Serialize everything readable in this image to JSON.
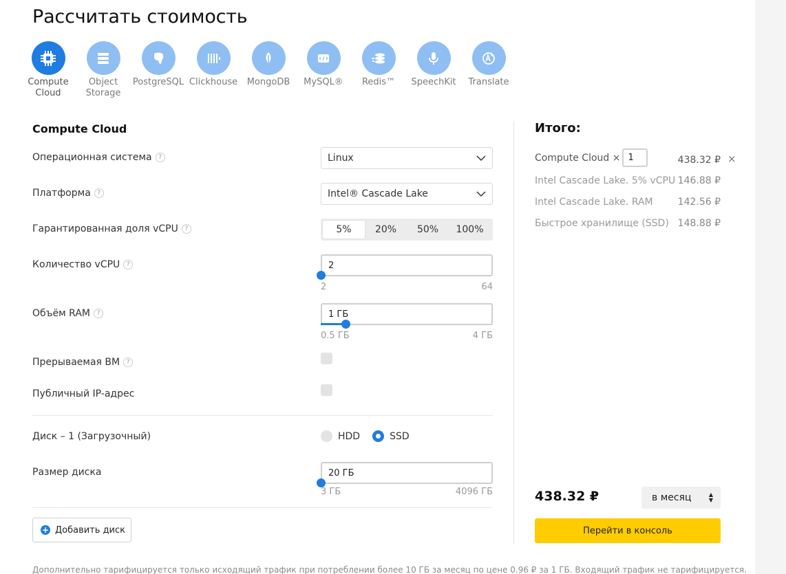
{
  "page_title": "Рассчитать стоимость",
  "services": [
    {
      "label": "Compute\nCloud",
      "icon": "chip-icon",
      "active": true
    },
    {
      "label": "Object\nStorage",
      "icon": "storage-icon",
      "active": false
    },
    {
      "label": "PostgreSQL",
      "icon": "postgresql-icon",
      "active": false
    },
    {
      "label": "Clickhouse",
      "icon": "clickhouse-icon",
      "active": false
    },
    {
      "label": "MongoDB",
      "icon": "mongodb-icon",
      "active": false
    },
    {
      "label": "MySQL®",
      "icon": "mysql-icon",
      "active": false
    },
    {
      "label": "Redis™",
      "icon": "redis-icon",
      "active": false
    },
    {
      "label": "SpeechKit",
      "icon": "microphone-icon",
      "active": false
    },
    {
      "label": "Translate",
      "icon": "translate-icon",
      "active": false
    }
  ],
  "config": {
    "section_title": "Compute Cloud",
    "os": {
      "label": "Операционная система",
      "value": "Linux"
    },
    "platform": {
      "label": "Платформа",
      "value": "Intel® Cascade Lake"
    },
    "vcpu_share": {
      "label": "Гарантированная доля vCPU",
      "options": [
        "5%",
        "20%",
        "50%",
        "100%"
      ],
      "selected": "5%"
    },
    "vcpu_count": {
      "label": "Количество vCPU",
      "value": "2",
      "min": "2",
      "max": "64",
      "level": 0.0
    },
    "ram": {
      "label": "Объём RAM",
      "value": "1 ГБ",
      "min": "0.5 ГБ",
      "max": "4 ГБ",
      "level": 0.143
    },
    "preemptible": {
      "label": "Прерываемая ВМ",
      "checked": false
    },
    "public_ip": {
      "label": "Публичный IP-адрес",
      "checked": false
    },
    "disk": {
      "label": "Диск – 1 (Загрузочный)",
      "options": [
        "HDD",
        "SSD"
      ],
      "selected": "SSD"
    },
    "disk_size": {
      "label": "Размер диска",
      "value": "20 ГБ",
      "min": "3 ГБ",
      "max": "4096 ГБ",
      "level": 0.0
    },
    "add_disk_label": "Добавить диск",
    "help_glyph": "?"
  },
  "summary": {
    "title": "Итого:",
    "main_item": {
      "name": "Compute Cloud ×",
      "qty": "1",
      "price": "438.32 ₽"
    },
    "items": [
      {
        "name": "Intel Cascade Lake. 5% vCPU",
        "price": "146.88 ₽"
      },
      {
        "name": "Intel Cascade Lake. RAM",
        "price": "142.56 ₽"
      },
      {
        "name": "Быстрое хранилище (SSD)",
        "price": "148.88 ₽"
      }
    ],
    "total": "438.32 ₽",
    "period": "в месяц",
    "console_button": "Перейти в консоль",
    "remove_glyph": "×"
  },
  "footnote": "Дополнительно тарифицируется только исходящий трафик при потреблении более 10 ГБ за месяц по цене 0.96 ₽ за 1 ГБ. Входящий трафик не тарифицируется.",
  "colors": {
    "accent": "#1f7ce0",
    "icon_inactive": "#8fbff2",
    "button_yellow": "#ffcc00"
  }
}
